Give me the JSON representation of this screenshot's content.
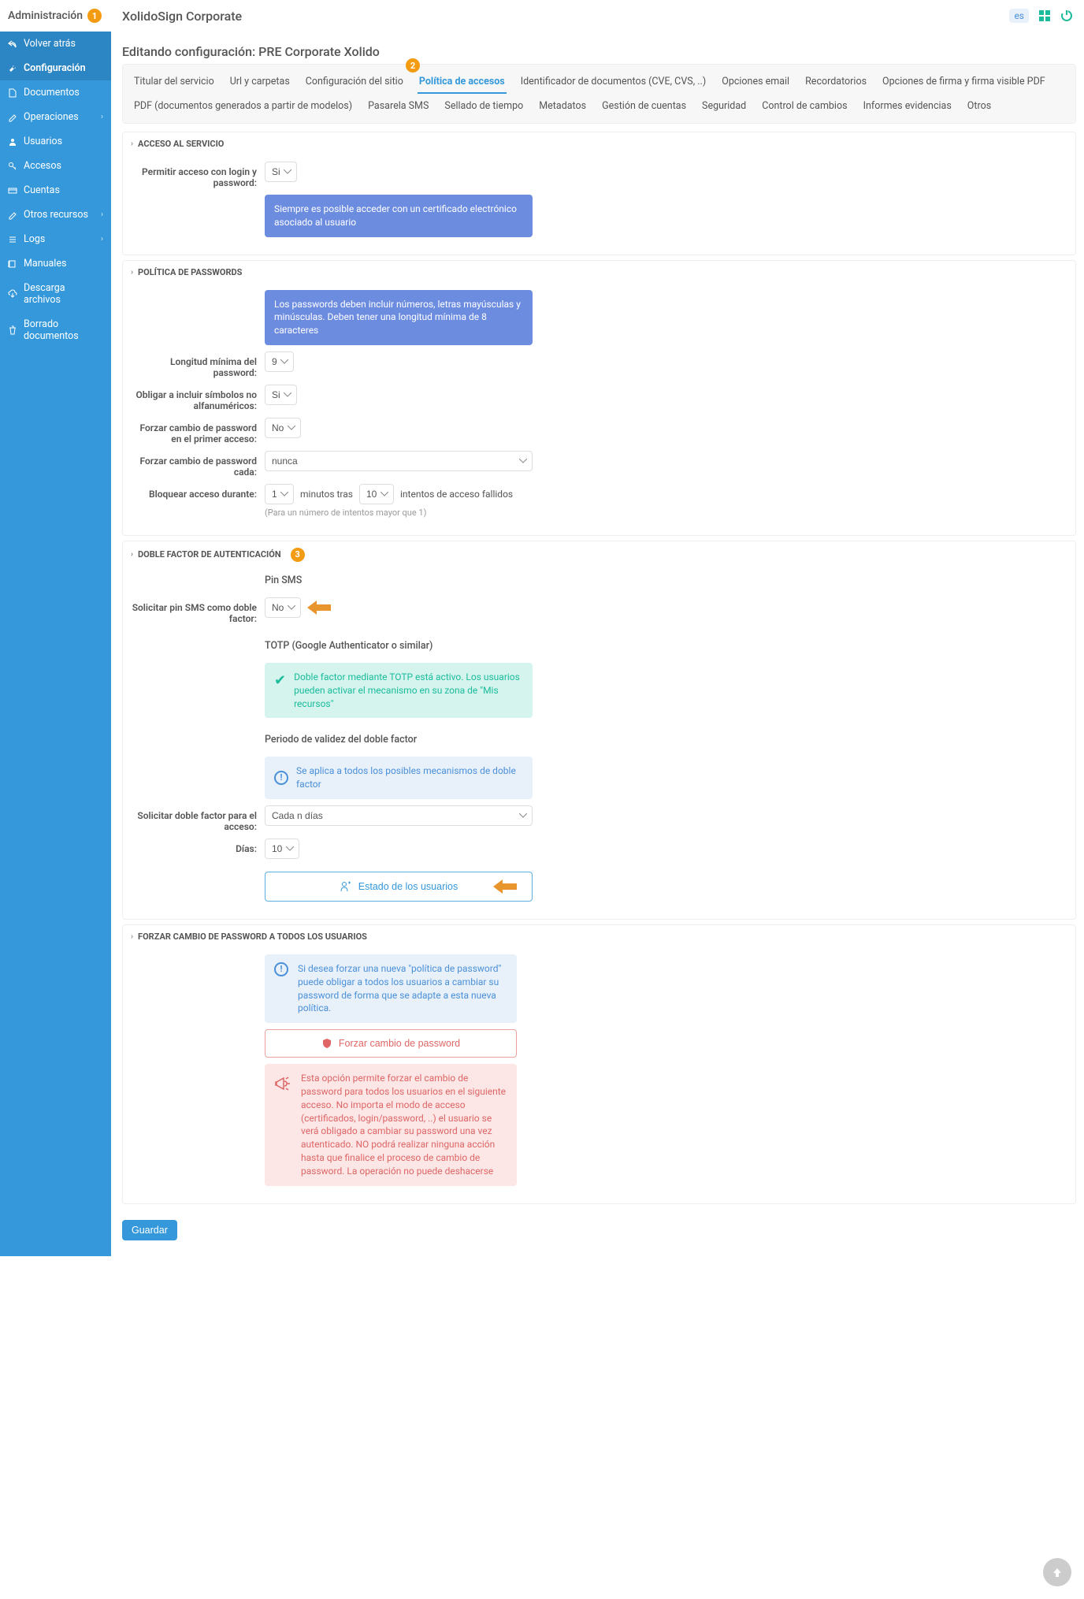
{
  "top": {
    "admin_label": "Administración",
    "brand": "XolidoSign Corporate",
    "lang": "es"
  },
  "sidebar": {
    "back": "Volver atrás",
    "items": [
      "Configuración",
      "Documentos",
      "Operaciones",
      "Usuarios",
      "Accesos",
      "Cuentas",
      "Otros recursos",
      "Logs",
      "Manuales",
      "Descarga archivos",
      "Borrado documentos"
    ]
  },
  "page_title": "Editando configuración: PRE Corporate Xolido",
  "tabs": [
    "Titular del servicio",
    "Url y carpetas",
    "Configuración del sitio",
    "Política de accesos",
    "Identificador de documentos (CVE, CVS, ..)",
    "Opciones email",
    "Recordatorios",
    "Opciones de firma y firma visible PDF",
    "PDF (documentos generados a partir de modelos)",
    "Pasarela SMS",
    "Sellado de tiempo",
    "Metadatos",
    "Gestión de cuentas",
    "Seguridad",
    "Control de cambios",
    "Informes evidencias",
    "Otros"
  ],
  "active_tab": "Política de accesos",
  "sections": {
    "acceso": {
      "title": "ACCESO AL SERVICIO",
      "label_allow": "Permitir acceso con login y password:",
      "allow_value": "Si",
      "info": "Siempre es posible acceder con un certificado electrónico asociado al usuario"
    },
    "politica": {
      "title": "POLÍTICA DE PASSWORDS",
      "info": "Los passwords deben incluir números, letras mayúsculas y minúsculas. Deben tener una longitud mínima de 8 caracteres",
      "label_long": "Longitud mínima del password:",
      "long_value": "9",
      "label_simb": "Obligar a incluir símbolos no alfanuméricos:",
      "simb_value": "Si",
      "label_forzar1": "Forzar cambio de password en el primer acceso:",
      "forzar1_value": "No",
      "label_forzar_cada": "Forzar cambio de password cada:",
      "forzar_cada_value": "nunca",
      "label_bloquear": "Bloquear acceso durante:",
      "bloq_min": "1",
      "bloq_mid": "minutos tras",
      "bloq_int": "10",
      "bloq_tail": "intentos de acceso fallidos",
      "bloq_note": "(Para un número de intentos mayor que 1)"
    },
    "doble": {
      "title": "DOBLE FACTOR DE AUTENTICACIÓN",
      "pin_sms_heading": "Pin SMS",
      "label_pin": "Solicitar pin SMS como doble factor:",
      "pin_value": "No",
      "totp_heading": "TOTP (Google Authenticator o similar)",
      "totp_info": "Doble factor mediante TOTP está activo. Los usuarios pueden activar el mecanismo en su zona de \"Mis recursos\"",
      "periodo_heading": "Periodo de validez del doble factor",
      "periodo_info": "Se aplica a todos los posibles mecanismos de doble factor",
      "label_solicitar": "Solicitar doble factor para el acceso:",
      "solicitar_value": "Cada n días",
      "label_dias": "Días:",
      "dias_value": "10",
      "btn_estado": "Estado de los usuarios"
    },
    "forzar": {
      "title": "FORZAR CAMBIO DE PASSWORD A TODOS LOS USUARIOS",
      "info_blue": "Si desea forzar una nueva \"política de password\" puede obligar a todos los usuarios a cambiar su password de forma que se adapte a esta nueva política.",
      "btn_forzar": "Forzar cambio de password",
      "info_red": "Esta opción permite forzar el cambio de password para todos los usuarios en el siguiente acceso. No importa el modo de acceso (certificados, login/password, ..) el usuario se verá obligado a cambiar su password una vez autenticado. NO podrá realizar ninguna acción hasta que finalice el proceso de cambio de password. La operación no puede deshacerse"
    }
  },
  "save_label": "Guardar",
  "badges": {
    "b1": "1",
    "b2": "2",
    "b3": "3"
  }
}
